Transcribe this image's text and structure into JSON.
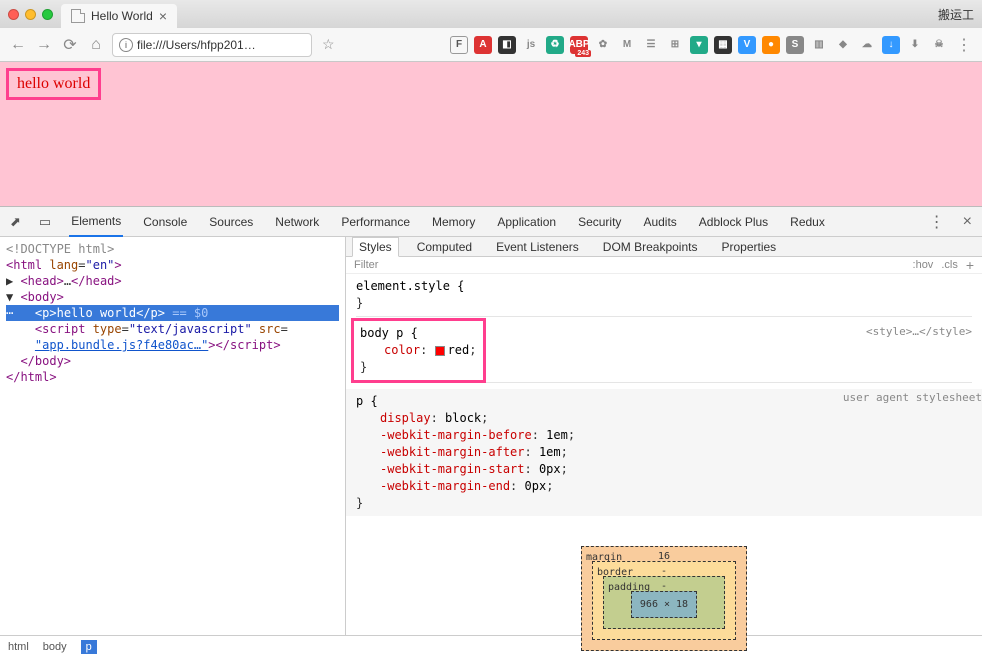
{
  "chrome": {
    "tab_title": "Hello World",
    "right_label": "搬运工",
    "url": "file:///Users/hfpp201…"
  },
  "page": {
    "hello": "hello world"
  },
  "devtools": {
    "tabs": [
      "Elements",
      "Console",
      "Sources",
      "Network",
      "Performance",
      "Memory",
      "Application",
      "Security",
      "Audits",
      "Adblock Plus",
      "Redux"
    ],
    "active_tab": "Elements",
    "tree": {
      "doctype": "<!DOCTYPE html>",
      "html_open": "<html lang=\"en\">",
      "head": "<head>…</head>",
      "body_open": "<body>",
      "p_open": "<p>",
      "p_text": "hello world",
      "p_close": "</p>",
      "eq": " == $0",
      "script_open": "<script type=\"text/javascript\" src=",
      "script_src": "\"app.bundle.js?f4e80ac…\"",
      "script_close": "></script>",
      "body_close": "</body>",
      "html_close": "</html>"
    },
    "crumbs": [
      "html",
      "body",
      "p"
    ]
  },
  "styles": {
    "sub_tabs": [
      "Styles",
      "Computed",
      "Event Listeners",
      "DOM Breakpoints",
      "Properties"
    ],
    "filter_placeholder": "Filter",
    "hov": ":hov",
    "cls": ".cls",
    "element_style": "element.style {",
    "close_brace": "}",
    "rule1_sel": "body p {",
    "rule1_prop": "color",
    "rule1_val": "red",
    "rule1_origin": "<style>…</style>",
    "rule2_sel": "p {",
    "rule2_origin": "user agent stylesheet",
    "rule2_props": [
      {
        "n": "display",
        "v": "block"
      },
      {
        "n": "-webkit-margin-before",
        "v": "1em"
      },
      {
        "n": "-webkit-margin-after",
        "v": "1em"
      },
      {
        "n": "-webkit-margin-start",
        "v": "0px"
      },
      {
        "n": "-webkit-margin-end",
        "v": "0px"
      }
    ],
    "box": {
      "margin_label": "margin",
      "margin_top": "16",
      "border_label": "border",
      "border_top": "-",
      "padding_label": "padding",
      "padding_top": "-",
      "content": "966 × 18"
    }
  }
}
